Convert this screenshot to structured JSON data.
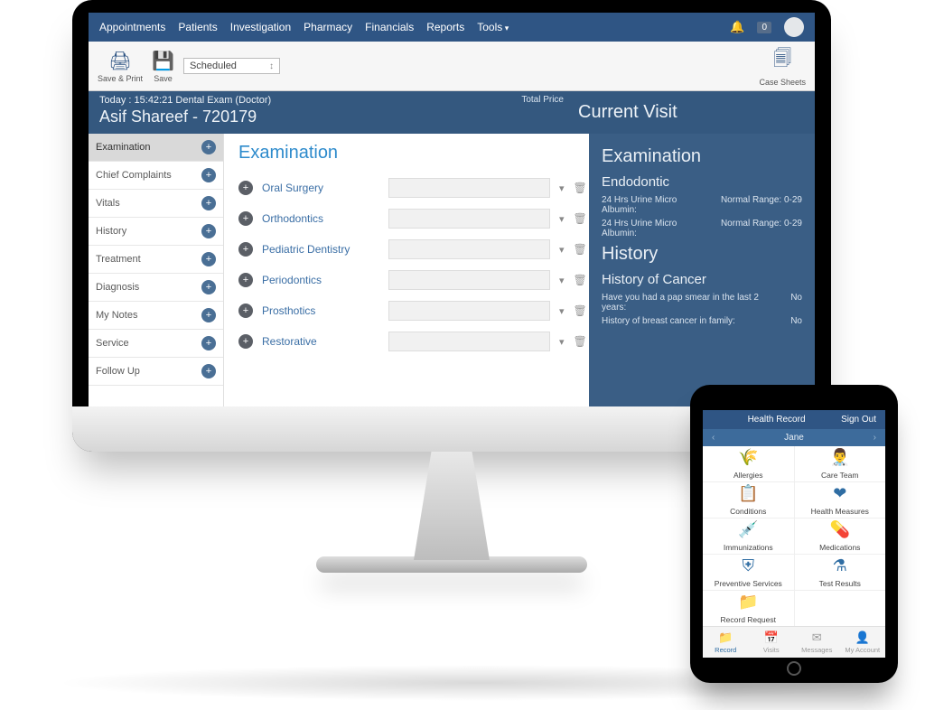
{
  "menubar": {
    "items": [
      "Appointments",
      "Patients",
      "Investigation",
      "Pharmacy",
      "Financials",
      "Reports",
      "Tools"
    ],
    "badge": "0"
  },
  "toolbar": {
    "save_print": "Save & Print",
    "save": "Save",
    "scheduled_label": "Scheduled",
    "case_sheets": "Case Sheets"
  },
  "context": {
    "today_line": "Today : 15:42:21   Dental Exam (Doctor)",
    "patient_line": "Asif Shareef - 720179",
    "total_price_label": "Total Price"
  },
  "leftnav": {
    "items": [
      "Examination",
      "Chief Complaints",
      "Vitals",
      "History",
      "Treatment",
      "Diagnosis",
      "My Notes",
      "Service",
      "Follow Up"
    ],
    "active_index": 0
  },
  "center": {
    "title": "Examination",
    "rows": [
      "Oral Surgery",
      "Orthodontics",
      "Pediatric Dentistry",
      "Periodontics",
      "Prosthotics",
      "Restorative"
    ]
  },
  "rightpanel": {
    "current_visit": "Current Visit",
    "exam_heading": "Examination",
    "endodontic_heading": "Endodontic",
    "endodontic_rows": [
      {
        "k": "24 Hrs Urine Micro Albumin:",
        "v": "Normal Range: 0-29"
      },
      {
        "k": "24 Hrs Urine Micro Albumin:",
        "v": "Normal Range: 0-29"
      }
    ],
    "history_heading": "History",
    "history_sub": "History of Cancer",
    "history_rows": [
      {
        "k": "Have you had a pap smear in the last 2 years:",
        "v": "No"
      },
      {
        "k": "History of breast cancer in family:",
        "v": "No"
      }
    ]
  },
  "ipad": {
    "top": {
      "title": "Health Record",
      "signout": "Sign Out"
    },
    "sub": {
      "name": "Jane"
    },
    "tiles": [
      {
        "label": "Allergies",
        "icon": "🌾"
      },
      {
        "label": "Care Team",
        "icon": "👨‍⚕️"
      },
      {
        "label": "Conditions",
        "icon": "📋"
      },
      {
        "label": "Health Measures",
        "icon": "❤"
      },
      {
        "label": "Immunizations",
        "icon": "💉"
      },
      {
        "label": "Medications",
        "icon": "💊"
      },
      {
        "label": "Preventive Services",
        "icon": "⛨"
      },
      {
        "label": "Test Results",
        "icon": "⚗"
      },
      {
        "label": "Record Request",
        "icon": "📁"
      }
    ],
    "tabs": [
      {
        "label": "Record",
        "icon": "📁",
        "active": true
      },
      {
        "label": "Visits",
        "icon": "📅",
        "active": false
      },
      {
        "label": "Messages",
        "icon": "✉",
        "active": false
      },
      {
        "label": "My Account",
        "icon": "👤",
        "active": false
      }
    ]
  }
}
